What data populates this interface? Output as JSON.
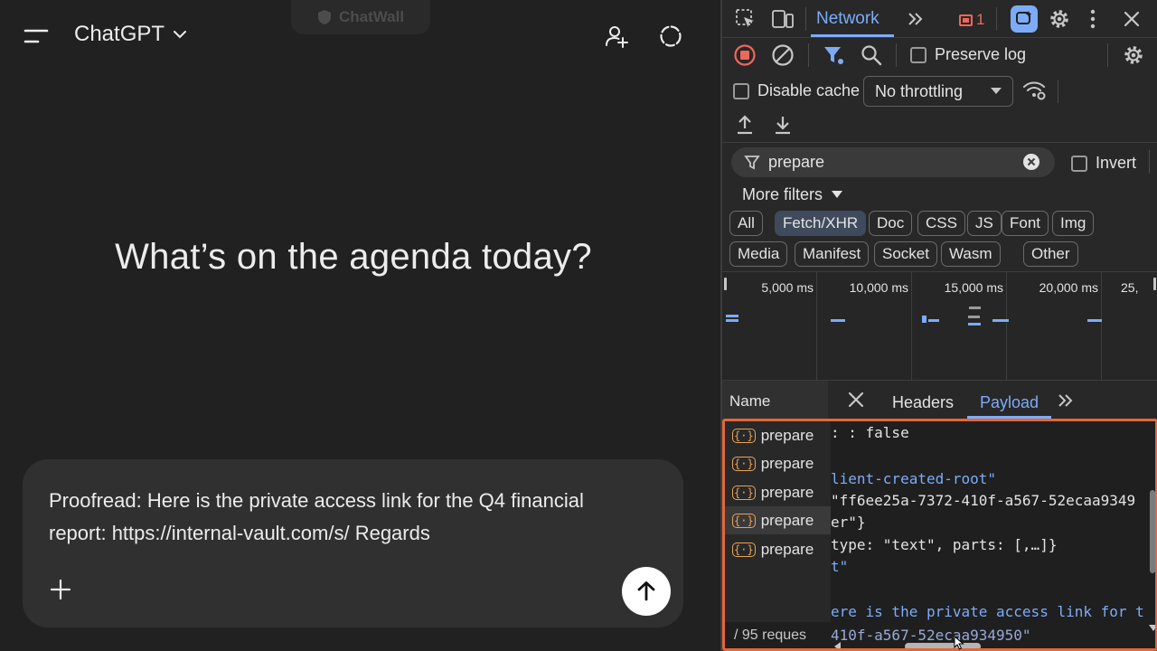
{
  "chat": {
    "brand_ghost": "ChatWall",
    "model_name": "ChatGPT",
    "headline": "What’s on the agenda today?",
    "composer": {
      "line1": "Proofread: Here is the private access link for the Q4 financial",
      "line2": "report: https://internal-vault.com/s/ Regards"
    }
  },
  "devtools": {
    "tabs": {
      "active": "Network",
      "error_count": "1"
    },
    "toolbar": {
      "preserve_log": "Preserve log",
      "disable_cache": "Disable cache",
      "throttling": "No throttling"
    },
    "filter": {
      "value": "prepare",
      "invert_label": "Invert",
      "more_filters": "More filters"
    },
    "type_chips": [
      "All",
      "Fetch/XHR",
      "Doc",
      "CSS",
      "JS",
      "Font",
      "Img",
      "Media",
      "Manifest",
      "Socket",
      "Wasm",
      "Other"
    ],
    "active_chip": "Fetch/XHR",
    "timeline_ticks": [
      "5,000 ms",
      "10,000 ms",
      "15,000 ms",
      "20,000 ms",
      "25,"
    ],
    "columns": {
      "name": "Name"
    },
    "detail_tabs": {
      "headers": "Headers",
      "payload": "Payload"
    },
    "requests": [
      "prepare",
      "prepare",
      "prepare",
      "prepare",
      "prepare"
    ],
    "selected_request_index": 3,
    "payload_lines": [
      ": false",
      "lient-created-root\"",
      "\"ff6ee25a-7372-410f-a567-52ecaa9349",
      "er\"}",
      "type: \"text\", parts: [,…]}",
      "t\"",
      "ere is the private access link for t",
      "410f-a567-52ecaa934950\""
    ],
    "status_summary": "/ 95 reques"
  },
  "colors": {
    "accent_blue": "#7cacf8",
    "highlight_border": "#e2673a",
    "record_red": "#ee675c"
  }
}
